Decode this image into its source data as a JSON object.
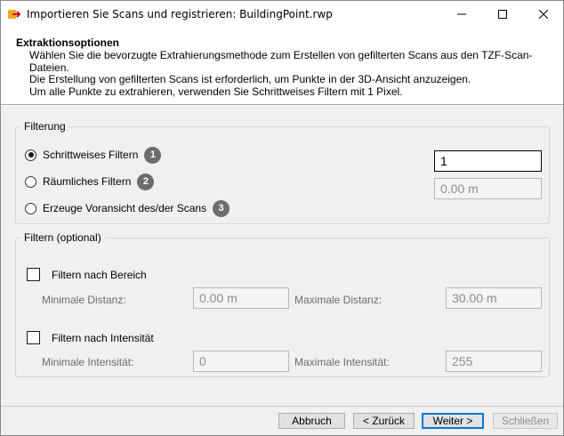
{
  "window": {
    "title": "Importieren Sie Scans und registrieren: BuildingPoint.rwp",
    "icon": "app-import-icon"
  },
  "header": {
    "title": "Extraktionsoptionen",
    "description": "Wählen Sie die bevorzugte Extrahierungsmethode zum Erstellen von gefilterten Scans aus den TZF-Scan-\nDateien.\nDie Erstellung von gefilterten Scans ist erforderlich, um Punkte in der 3D-Ansicht anzuzeigen.\nUm alle Punkte zu extrahieren, verwenden Sie Schrittweises Filtern mit 1 Pixel."
  },
  "filterung": {
    "legend": "Filterung",
    "options": [
      {
        "label": "Schrittweises Filtern",
        "badge": "1",
        "checked": true
      },
      {
        "label": "Räumliches Filtern",
        "badge": "2",
        "checked": false
      },
      {
        "label": "Erzeuge Voransicht des/der Scans",
        "badge": "3",
        "checked": false
      }
    ],
    "step_value": "1",
    "spatial_value": "0.00 m"
  },
  "filtern": {
    "legend": "Filtern (optional)",
    "range": {
      "label": "Filtern nach Bereich",
      "min_label": "Minimale Distanz:",
      "min_value": "0.00 m",
      "max_label": "Maximale Distanz:",
      "max_value": "30.00 m"
    },
    "intensity": {
      "label": "Filtern nach Intensität",
      "min_label": "Minimale Intensität:",
      "min_value": "0",
      "max_label": "Maximale Intensität:",
      "max_value": "255"
    }
  },
  "buttons": {
    "cancel": "Abbruch",
    "back": "< Zurück",
    "next": "Weiter >",
    "close": "Schließen"
  },
  "colors": {
    "accent": "#0078d7",
    "badge": "#6d6d6d"
  }
}
